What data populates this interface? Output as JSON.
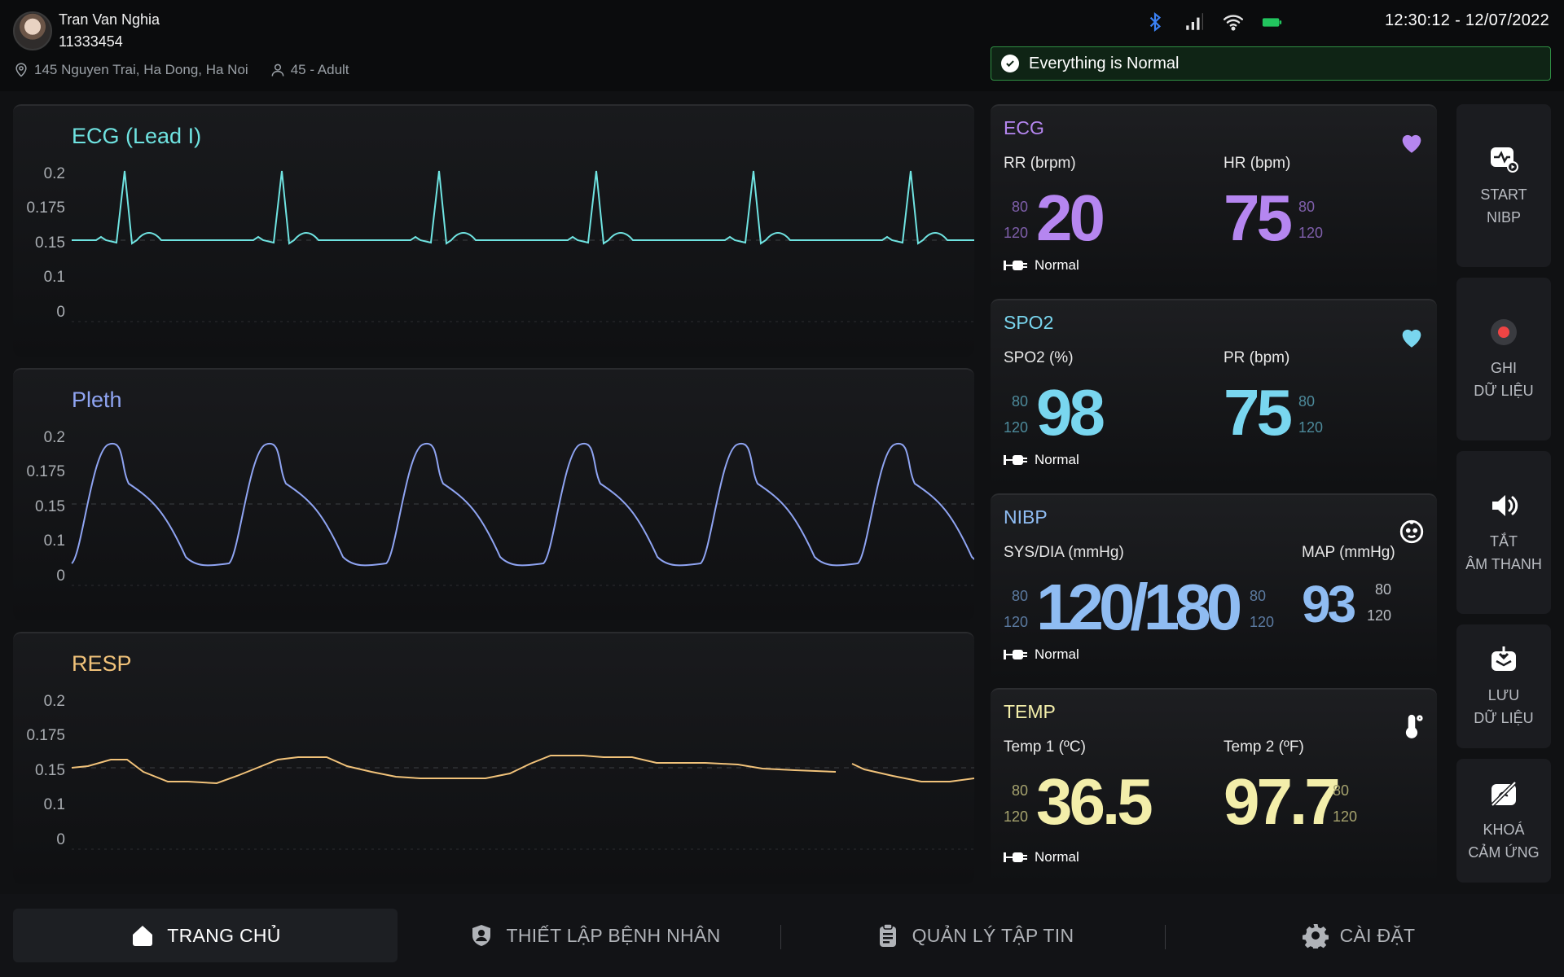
{
  "patient": {
    "name": "Tran Van Nghia",
    "id": "11333454",
    "address": "145 Nguyen Trai, Ha Dong, Ha Noi",
    "age_group": "45 - Adult"
  },
  "status_bar": {
    "datetime": "12:30:12 - 12/07/2022",
    "icons": [
      "bluetooth-icon",
      "signal-icon",
      "wifi-icon",
      "battery-icon"
    ]
  },
  "alert": {
    "text": "Everything is Normal",
    "color": "#2f8f43"
  },
  "waves": [
    {
      "title": "ECG (Lead I)",
      "color": "#6fe3e1",
      "y_ticks": [
        "0.2",
        "0.175",
        "0.15",
        "0.1",
        "0"
      ]
    },
    {
      "title": "Pleth",
      "color": "#8fa4f2",
      "y_ticks": [
        "0.2",
        "0.175",
        "0.15",
        "0.1",
        "0"
      ]
    },
    {
      "title": "RESP",
      "color": "#f1c27a",
      "y_ticks": [
        "0.2",
        "0.175",
        "0.15",
        "0.1",
        "0"
      ]
    }
  ],
  "cards": {
    "ecg": {
      "title": "ECG",
      "left_label": "RR (brpm)",
      "left_value": "20",
      "left_hi": "80",
      "left_lo": "120",
      "right_label": "HR (bpm)",
      "right_value": "75",
      "right_hi": "80",
      "right_lo": "120",
      "status": "Normal",
      "color": "#b586f0",
      "icon": "heart-icon"
    },
    "spo2": {
      "title": "SPO2",
      "left_label": "SPO2 (%)",
      "left_value": "98",
      "left_hi": "80",
      "left_lo": "120",
      "right_label": "PR (bpm)",
      "right_value": "75",
      "right_hi": "80",
      "right_lo": "120",
      "status": "Normal",
      "color": "#79d6ef",
      "icon": "heart-icon"
    },
    "nibp": {
      "title": "NIBP",
      "left_label": "SYS/DIA (mmHg)",
      "left_value": "120/180",
      "left_hi": "80",
      "left_lo": "120",
      "left_hi2": "80",
      "left_lo2": "120",
      "right_label": "MAP (mmHg)",
      "right_value": "93",
      "right_hi": "80",
      "right_lo": "120",
      "status": "Normal",
      "color": "#8fbcf2",
      "icon": "baby-face-icon"
    },
    "temp": {
      "title": "TEMP",
      "left_label": "Temp 1 (ºC)",
      "left_value": "36.5",
      "left_hi": "80",
      "left_lo": "120",
      "right_label": "Temp 2 (ºF)",
      "right_value": "97.7",
      "right_hi": "80",
      "right_lo": "120",
      "status": "Normal",
      "color": "#f3eeaa",
      "icon": "thermometer-icon"
    }
  },
  "side_buttons": [
    {
      "line1": "START",
      "line2": "NIBP",
      "icon": "nibp-start-icon"
    },
    {
      "line1": "GHI",
      "line2": "DỮ LIỆU",
      "icon": "record-icon"
    },
    {
      "line1": "TẮT",
      "line2": "ÂM THANH",
      "icon": "speaker-icon"
    },
    {
      "line1": "LƯU",
      "line2": "DỮ LIỆU",
      "icon": "save-box-icon"
    },
    {
      "line1": "KHOÁ",
      "line2": "CẢM ỨNG",
      "icon": "touch-lock-icon"
    }
  ],
  "nav": [
    {
      "label": "TRANG CHỦ",
      "icon": "home-icon",
      "active": true
    },
    {
      "label": "THIẾT LẬP BỆNH NHÂN",
      "icon": "patient-icon",
      "active": false
    },
    {
      "label": "QUẢN LÝ TẬP TIN",
      "icon": "clipboard-icon",
      "active": false
    },
    {
      "label": "CÀI ĐẶT",
      "icon": "gear-icon",
      "active": false
    }
  ]
}
